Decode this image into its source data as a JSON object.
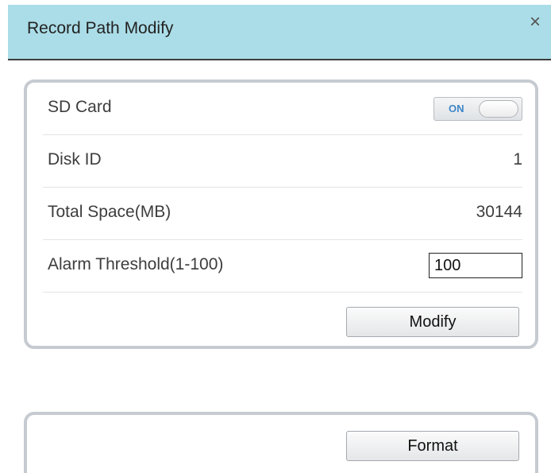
{
  "dialog": {
    "title": "Record Path Modify",
    "close_symbol": "×"
  },
  "sd_card": {
    "label": "SD Card",
    "toggle_state": "ON"
  },
  "disk_id": {
    "label": "Disk ID",
    "value": "1"
  },
  "total_space": {
    "label": "Total Space(MB)",
    "value": "30144"
  },
  "alarm_threshold": {
    "label": "Alarm Threshold(1-100)",
    "value": "100"
  },
  "buttons": {
    "modify_label": "Modify",
    "format_label": "Format"
  },
  "colors": {
    "titlebar_bg": "#abdde8",
    "toggle_on_text": "#3d87c9",
    "panel_border": "#c6cbd1"
  }
}
